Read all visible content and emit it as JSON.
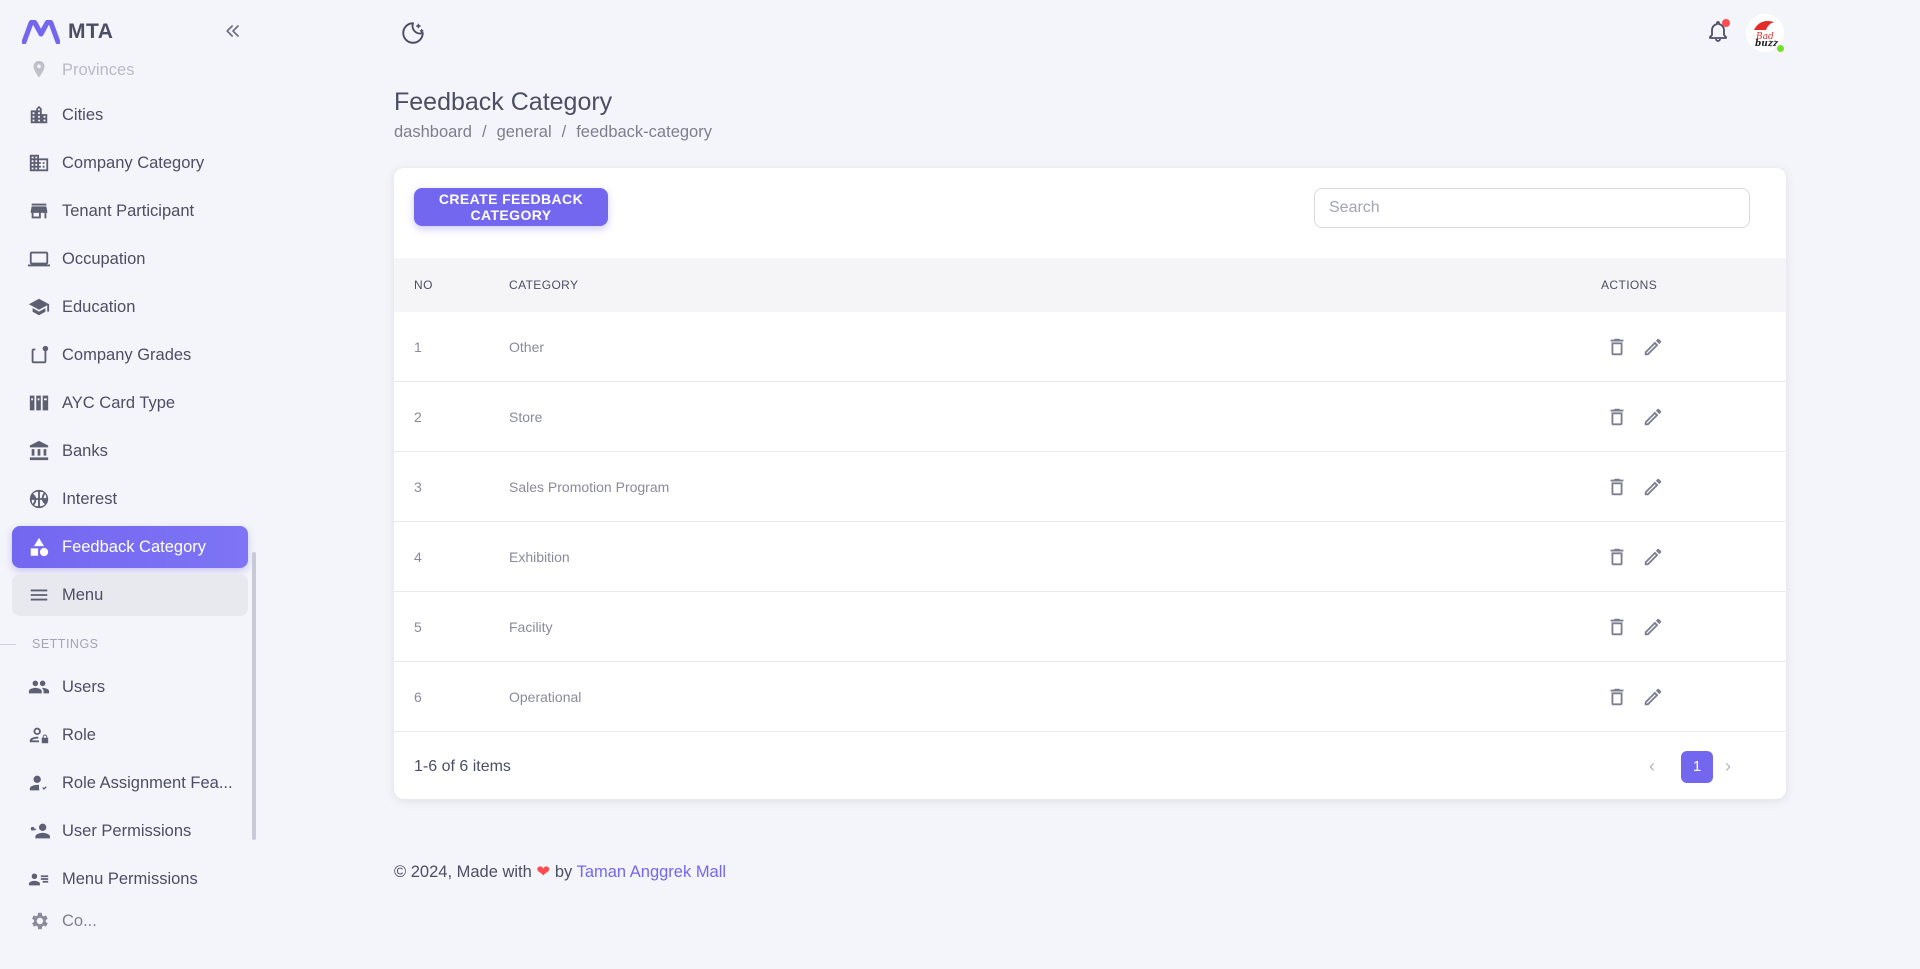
{
  "app": {
    "name": "MTA",
    "logo_icon": "mta-logo-icon",
    "accent": "#7367f0"
  },
  "sidebar": {
    "items": [
      {
        "label": "Provinces",
        "icon": "map-pin-icon"
      },
      {
        "label": "Cities",
        "icon": "city-icon"
      },
      {
        "label": "Company Category",
        "icon": "office-building-icon"
      },
      {
        "label": "Tenant Participant",
        "icon": "storefront-icon"
      },
      {
        "label": "Occupation",
        "icon": "laptop-icon"
      },
      {
        "label": "Education",
        "icon": "graduation-cap-icon"
      },
      {
        "label": "Company Grades",
        "icon": "grade-badge-icon"
      },
      {
        "label": "AYC Card Type",
        "icon": "card-stack-icon"
      },
      {
        "label": "Banks",
        "icon": "bank-icon"
      },
      {
        "label": "Interest",
        "icon": "basketball-icon"
      },
      {
        "label": "Feedback Category",
        "icon": "shapes-icon",
        "active": true
      },
      {
        "label": "Menu",
        "icon": "menu-icon"
      }
    ],
    "settings_section": "SETTINGS",
    "settings_items": [
      {
        "label": "Users",
        "icon": "users-icon"
      },
      {
        "label": "Role",
        "icon": "user-lock-icon"
      },
      {
        "label": "Role Assignment Fea...",
        "icon": "user-assign-icon"
      },
      {
        "label": "User Permissions",
        "icon": "user-key-icon"
      },
      {
        "label": "Menu Permissions",
        "icon": "user-list-icon"
      },
      {
        "label": "Co...",
        "icon": "gear-icon"
      }
    ]
  },
  "topbar": {
    "theme_icon": "moon-stars-icon",
    "notification_icon": "bell-icon",
    "avatar_icon": "bad-buzz-avatar"
  },
  "page": {
    "title": "Feedback Category",
    "breadcrumb": [
      "dashboard",
      "general",
      "feedback-category"
    ]
  },
  "toolbar": {
    "create_label": "CREATE FEEDBACK CATEGORY",
    "search_placeholder": "Search"
  },
  "table": {
    "headers": {
      "no": "NO",
      "category": "CATEGORY",
      "actions": "ACTIONS"
    },
    "rows": [
      {
        "no": "1",
        "category": "Other"
      },
      {
        "no": "2",
        "category": "Store"
      },
      {
        "no": "3",
        "category": "Sales Promotion Program"
      },
      {
        "no": "4",
        "category": "Exhibition"
      },
      {
        "no": "5",
        "category": "Facility"
      },
      {
        "no": "6",
        "category": "Operational"
      }
    ]
  },
  "pagination": {
    "summary": "1-6 of 6 items",
    "current_page": "1",
    "prev": "‹",
    "next": "›"
  },
  "footer": {
    "prefix": "© 2024, Made with",
    "heart": "❤",
    "by": "by",
    "link": "Taman Anggrek Mall"
  }
}
